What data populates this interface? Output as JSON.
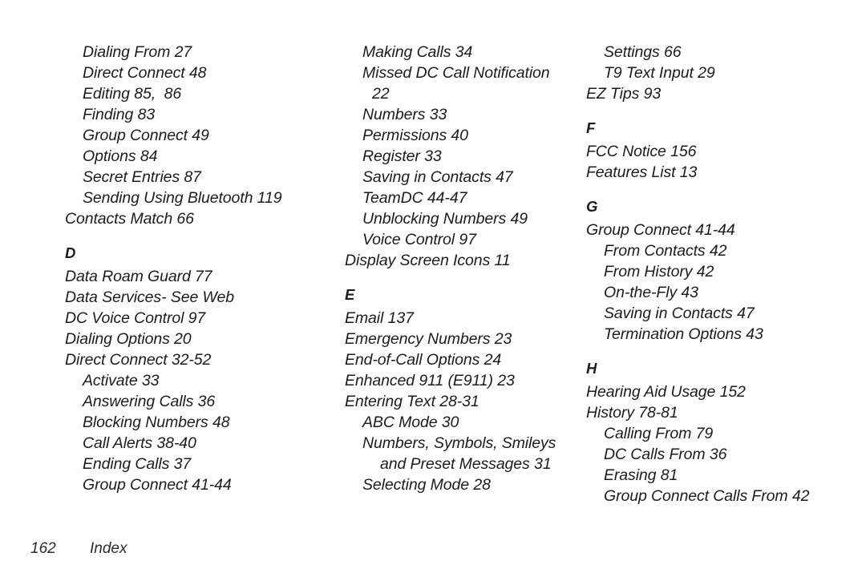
{
  "document": {
    "type": "index",
    "page_number": "162",
    "footer_label": "Index",
    "text_color": "#1c1c1c",
    "background_color": "#ffffff"
  },
  "columns": [
    {
      "name": "column-1",
      "blocks": [
        {
          "kind": "entries",
          "entries": [
            {
              "text": "Dialing From 27",
              "level": 1
            },
            {
              "text": "Direct Connect 48",
              "level": 1
            },
            {
              "text": "Editing 85,  86",
              "level": 1
            },
            {
              "text": "Finding 83",
              "level": 1
            },
            {
              "text": "Group Connect 49",
              "level": 1
            },
            {
              "text": "Options 84",
              "level": 1
            },
            {
              "text": "Secret Entries 87",
              "level": 1
            },
            {
              "text": "Sending Using Bluetooth 119",
              "level": 1
            },
            {
              "text": "Contacts Match 66",
              "level": 0
            }
          ]
        },
        {
          "kind": "heading",
          "letter": "D"
        },
        {
          "kind": "entries",
          "entries": [
            {
              "text": "Data Roam Guard 77",
              "level": 0
            },
            {
              "text": "Data Services- See Web",
              "level": 0
            },
            {
              "text": "DC Voice Control 97",
              "level": 0
            },
            {
              "text": "Dialing Options 20",
              "level": 0
            },
            {
              "text": "Direct Connect 32-52",
              "level": 0
            },
            {
              "text": "Activate 33",
              "level": 1
            },
            {
              "text": "Answering Calls 36",
              "level": 1
            },
            {
              "text": "Blocking Numbers 48",
              "level": 1
            },
            {
              "text": "Call Alerts 38-40",
              "level": 1
            },
            {
              "text": "Ending Calls 37",
              "level": 1
            },
            {
              "text": "Group Connect 41-44",
              "level": 1
            }
          ]
        }
      ]
    },
    {
      "name": "column-2",
      "blocks": [
        {
          "kind": "entries",
          "entries": [
            {
              "text": "Making Calls 34",
              "level": 1
            },
            {
              "text": "Missed DC Call Notification",
              "level": 1
            },
            {
              "text": "22",
              "level": 1,
              "continuation": 1
            },
            {
              "text": "Numbers 33",
              "level": 1
            },
            {
              "text": "Permissions 40",
              "level": 1
            },
            {
              "text": "Register 33",
              "level": 1
            },
            {
              "text": "Saving in Contacts 47",
              "level": 1
            },
            {
              "text": "TeamDC 44-47",
              "level": 1
            },
            {
              "text": "Unblocking Numbers 49",
              "level": 1
            },
            {
              "text": "Voice Control 97",
              "level": 1
            },
            {
              "text": "Display Screen Icons 11",
              "level": 0
            }
          ]
        },
        {
          "kind": "heading",
          "letter": "E"
        },
        {
          "kind": "entries",
          "entries": [
            {
              "text": "Email 137",
              "level": 0
            },
            {
              "text": "Emergency Numbers 23",
              "level": 0
            },
            {
              "text": "End-of-Call Options 24",
              "level": 0
            },
            {
              "text": "Enhanced 911 (E911) 23",
              "level": 0
            },
            {
              "text": "Entering Text 28-31",
              "level": 0
            },
            {
              "text": "ABC Mode 30",
              "level": 1
            },
            {
              "text": "Numbers, Symbols, Smileys",
              "level": 1
            },
            {
              "text": "and Preset Messages 31",
              "level": 1,
              "continuation": 2
            },
            {
              "text": "Selecting Mode 28",
              "level": 1
            }
          ]
        }
      ]
    },
    {
      "name": "column-3",
      "blocks": [
        {
          "kind": "entries",
          "entries": [
            {
              "text": "Settings 66",
              "level": 1
            },
            {
              "text": "T9 Text Input 29",
              "level": 1
            },
            {
              "text": "EZ Tips 93",
              "level": 0
            }
          ]
        },
        {
          "kind": "heading",
          "letter": "F"
        },
        {
          "kind": "entries",
          "entries": [
            {
              "text": "FCC Notice 156",
              "level": 0
            },
            {
              "text": "Features List 13",
              "level": 0
            }
          ]
        },
        {
          "kind": "heading",
          "letter": "G"
        },
        {
          "kind": "entries",
          "entries": [
            {
              "text": "Group Connect 41-44",
              "level": 0
            },
            {
              "text": "From Contacts 42",
              "level": 1
            },
            {
              "text": "From History 42",
              "level": 1
            },
            {
              "text": "On-the-Fly 43",
              "level": 1
            },
            {
              "text": "Saving in Contacts 47",
              "level": 1
            },
            {
              "text": "Termination Options 43",
              "level": 1
            }
          ]
        },
        {
          "kind": "heading",
          "letter": "H"
        },
        {
          "kind": "entries",
          "entries": [
            {
              "text": "Hearing Aid Usage 152",
              "level": 0
            },
            {
              "text": "History 78-81",
              "level": 0
            },
            {
              "text": "Calling From 79",
              "level": 1
            },
            {
              "text": "DC Calls From 36",
              "level": 1
            },
            {
              "text": "Erasing 81",
              "level": 1
            },
            {
              "text": "Group Connect Calls From 42",
              "level": 1
            }
          ]
        }
      ]
    }
  ]
}
